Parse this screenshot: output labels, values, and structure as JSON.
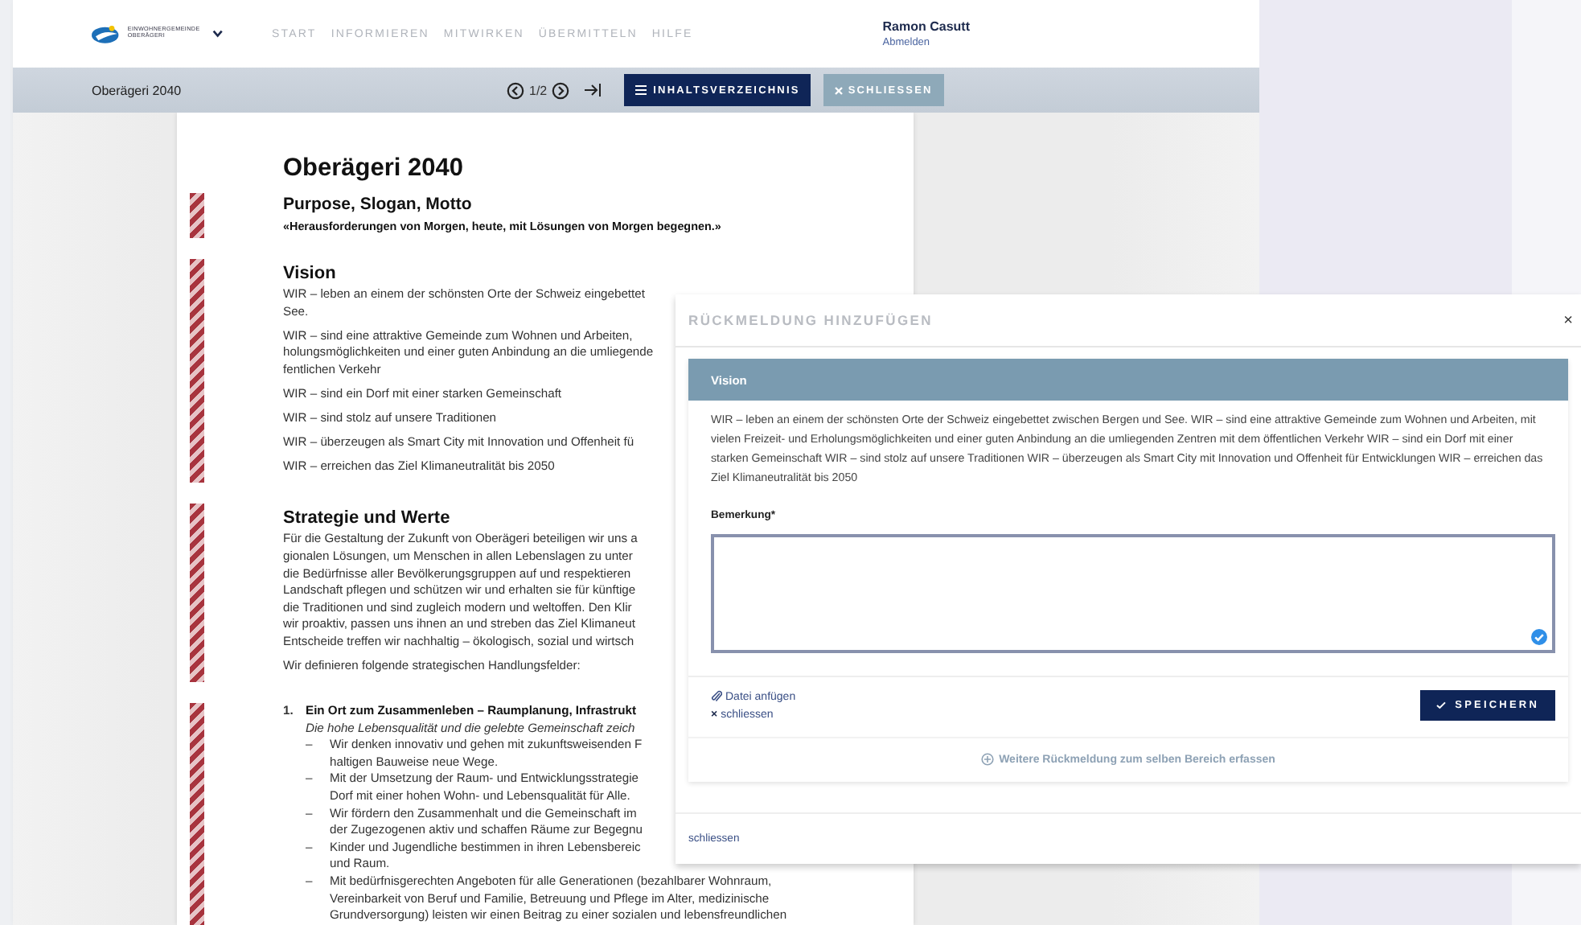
{
  "header": {
    "logo_lines": [
      "EINWOHNERGEMEINDE",
      "OBERÄGERI"
    ],
    "nav": [
      {
        "label": "START"
      },
      {
        "label": "INFORMIEREN"
      },
      {
        "label": "MITWIRKEN"
      },
      {
        "label": "ÜBERMITTELN"
      },
      {
        "label": "HILFE"
      }
    ],
    "user": {
      "name": "Ramon Casutt",
      "logout": "Abmelden"
    }
  },
  "toolbar": {
    "title": "Oberägeri 2040",
    "page": "1/2",
    "toc_button": "INHALTSVERZEICHNIS",
    "close_button": "SCHLIESSEN"
  },
  "document": {
    "title": "Oberägeri 2040",
    "sections": [
      {
        "blocks": [
          {
            "kind": "subtitle",
            "lines": [
              "Purpose, Slogan, Motto"
            ]
          },
          {
            "kind": "motto",
            "lines": [
              "«Herausforderungen von Morgen, heute, mit Lösungen von Morgen begegnen.»"
            ]
          }
        ]
      },
      {
        "blocks": [
          {
            "kind": "heading",
            "lines": [
              "Vision"
            ]
          },
          {
            "kind": "text",
            "lines": [
              "WIR – leben an einem der schönsten Orte der Schweiz eingebettet",
              "See."
            ]
          },
          {
            "kind": "text",
            "lines": [
              "WIR – sind eine attraktive Gemeinde zum Wohnen und Arbeiten,",
              "holungsmöglichkeiten und einer guten Anbindung an die umliegende",
              "fentlichen Verkehr"
            ]
          },
          {
            "kind": "text",
            "lines": [
              "WIR – sind ein Dorf mit einer starken Gemeinschaft"
            ]
          },
          {
            "kind": "text",
            "lines": [
              "WIR – sind stolz auf unsere Traditionen"
            ]
          },
          {
            "kind": "text",
            "lines": [
              "WIR – überzeugen als Smart City mit Innovation und Offenheit fü"
            ]
          },
          {
            "kind": "text",
            "lines": [
              "WIR – erreichen das Ziel Klimaneutralität bis 2050"
            ]
          }
        ]
      },
      {
        "blocks": [
          {
            "kind": "heading",
            "lines": [
              "Strategie und Werte"
            ]
          },
          {
            "kind": "text",
            "lines": [
              "Für die Gestaltung der Zukunft von Oberägeri beteiligen wir uns a",
              "gionalen Lösungen, um Menschen in allen Lebenslagen zu unter",
              "die Bedürfnisse aller Bevölkerungsgruppen auf und respektieren",
              "Landschaft pflegen und schützen wir und erhalten sie für künftige",
              "die Traditionen und sind zugleich modern und weltoffen. Den Klir",
              "wir proaktiv, passen uns ihnen an und streben das Ziel Klimaneut",
              "Entscheide treffen wir nachhaltig – ökologisch, sozial und wirtsch"
            ]
          },
          {
            "kind": "text",
            "lines": [
              "Wir definieren folgende strategischen Handlungsfelder:"
            ]
          }
        ]
      },
      {
        "blocks": [
          {
            "kind": "numbered",
            "marker": "1.",
            "lines": [
              "Ein Ort zum Zusammenleben – Raumplanung, Infrastrukt"
            ]
          },
          {
            "kind": "italic",
            "lines": [
              "Die hohe Lebensqualität und die gelebte Gemeinschaft zeich"
            ]
          },
          {
            "kind": "bullet",
            "marker": "–",
            "lines": [
              "Wir denken innovativ und gehen mit zukunftsweisenden F",
              "haltigen Bauweise neue Wege."
            ]
          },
          {
            "kind": "bullet",
            "marker": "–",
            "lines": [
              "Mit der Umsetzung der Raum- und Entwicklungsstrategie",
              "Dorf mit einer hohen Wohn- und Lebensqualität für Alle."
            ]
          },
          {
            "kind": "bullet",
            "marker": "–",
            "lines": [
              "Wir fördern den Zusammenhalt und die Gemeinschaft im",
              "der Zugezogenen aktiv und schaffen Räume zur Begegnu"
            ]
          },
          {
            "kind": "bullet",
            "marker": "–",
            "lines": [
              "Kinder und Jugendliche bestimmen in ihren Lebensbereic",
              "und Raum."
            ]
          },
          {
            "kind": "bullet",
            "marker": "–",
            "lines": [
              "Mit bedürfnisgerechten Angeboten für alle Generationen (bezahlbarer Wohnraum,",
              "Vereinbarkeit von Beruf und Familie, Betreuung und Pflege im Alter, medizinische",
              "Grundversorgung) leisten wir einen Beitrag zu einer sozialen und lebensfreundlichen"
            ]
          }
        ]
      }
    ]
  },
  "modal": {
    "title": "RÜCKMELDUNG HINZUFÜGEN",
    "close": "×",
    "card": {
      "heading": "Vision",
      "text": "WIR – leben an einem der schönsten Orte der Schweiz eingebettet zwischen Bergen und See. WIR – sind eine attraktive Gemeinde zum Wohnen und Arbeiten, mit vielen Freizeit- und Erholungsmöglichkeiten und einer guten Anbindung an die umliegenden Zentren mit dem öffentlichen Verkehr WIR – sind ein Dorf mit einer starken Gemeinschaft WIR – sind stolz auf unsere Traditionen WIR – überzeugen als Smart City mit Innovation und Offenheit für Entwicklungen WIR – erreichen das Ziel Klimaneutralität bis 2050"
    },
    "field": {
      "label": "Bemerkung*"
    },
    "attach": "Datei anfügen",
    "cancel_icon": "×",
    "cancel": "schliessen",
    "save": "SPEICHERN",
    "more": "Weitere Rückmeldung zum selben Bereich erfassen",
    "footer_link": "schliessen"
  }
}
